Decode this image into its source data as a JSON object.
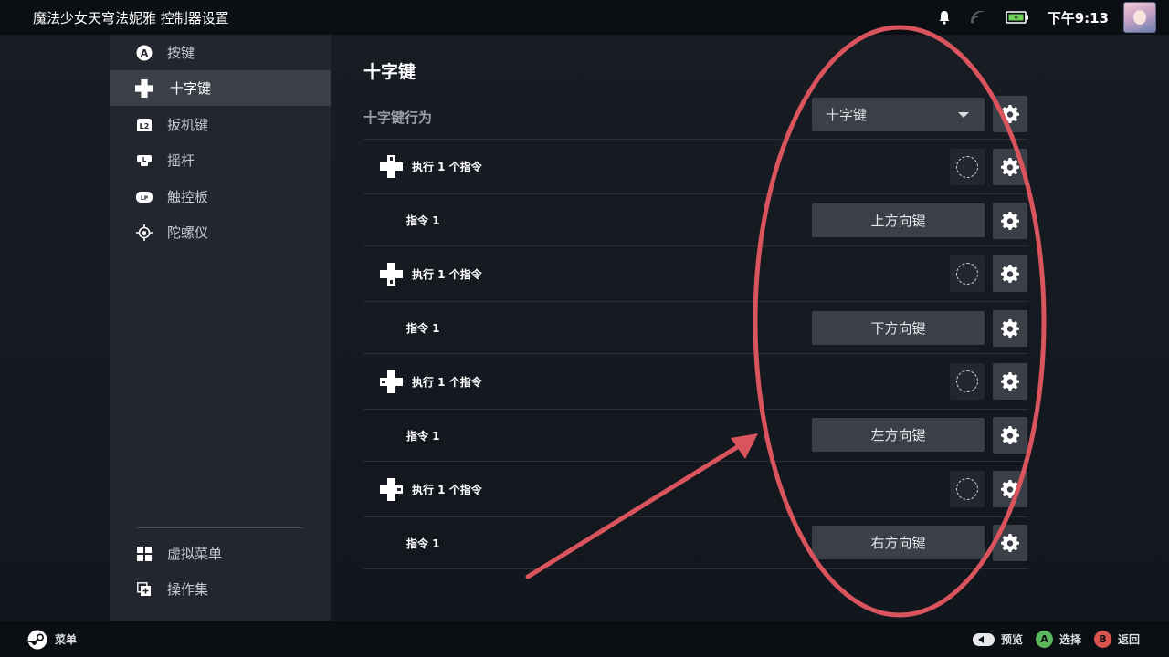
{
  "topbar": {
    "title": "魔法少女天穹法妮雅 控制器设置",
    "time": "下午9:13",
    "icons": [
      "bell-icon",
      "wifi-off-icon",
      "battery-icon",
      "avatar"
    ]
  },
  "sidebar": {
    "items": [
      {
        "label": "按键",
        "icon": "a-button-icon"
      },
      {
        "label": "十字键",
        "icon": "dpad-icon",
        "active": true
      },
      {
        "label": "扳机键",
        "icon": "l2-trigger-icon"
      },
      {
        "label": "摇杆",
        "icon": "joystick-icon"
      },
      {
        "label": "触控板",
        "icon": "trackpad-icon"
      },
      {
        "label": "陀螺仪",
        "icon": "gyro-icon"
      }
    ],
    "bottom_items": [
      {
        "label": "虚拟菜单",
        "icon": "grid-menu-icon"
      },
      {
        "label": "操作集",
        "icon": "action-set-icon"
      }
    ]
  },
  "main": {
    "title": "十字键",
    "behavior": {
      "label": "十字键行为",
      "value": "十字键"
    },
    "directions": [
      {
        "command_label": "执行 1 个指令",
        "sub_label": "指令 1",
        "binding": "上方向键",
        "dir": "up"
      },
      {
        "command_label": "执行 1 个指令",
        "sub_label": "指令 1",
        "binding": "下方向键",
        "dir": "down"
      },
      {
        "command_label": "执行 1 个指令",
        "sub_label": "指令 1",
        "binding": "左方向键",
        "dir": "left"
      },
      {
        "command_label": "执行 1 个指令",
        "sub_label": "指令 1",
        "binding": "右方向键",
        "dir": "right"
      }
    ]
  },
  "bottombar": {
    "menu_label": "菜单",
    "preview_label": "预览",
    "select_label": "选择",
    "back_label": "返回",
    "a_glyph": "A",
    "b_glyph": "B"
  },
  "colors": {
    "annotation": "#d9545c",
    "a_button": "#5cb85c",
    "b_button": "#d9534f"
  }
}
